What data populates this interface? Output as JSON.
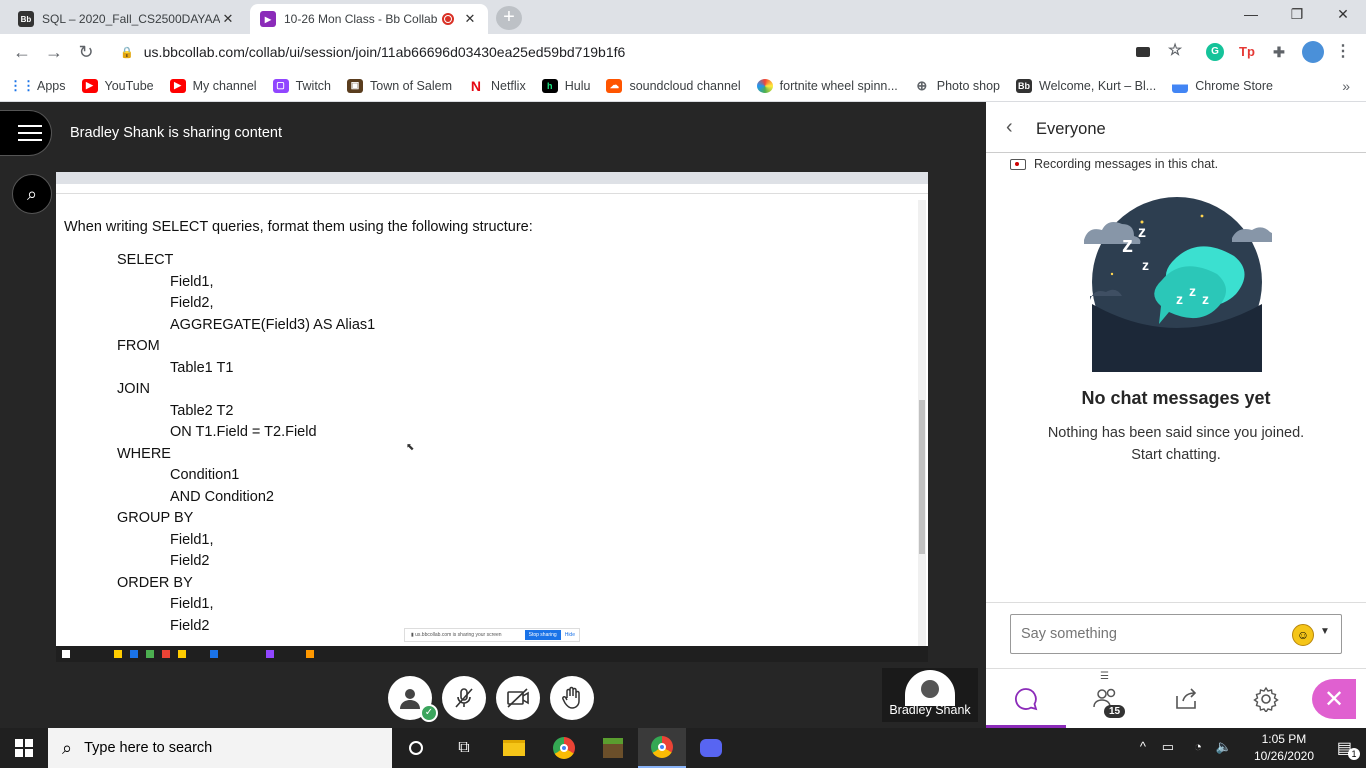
{
  "browser": {
    "tabs": [
      {
        "title": "SQL – 2020_Fall_CS2500DAYAA D",
        "favicon": "Bb",
        "active": false
      },
      {
        "title": "10-26 Mon Class - Bb Collab",
        "active": true
      }
    ],
    "url": "us.bbcollab.com/collab/ui/session/join/11ab66696d03430ea25ed59bd719b1f6",
    "bookmarks": [
      "Apps",
      "YouTube",
      "My channel",
      "Twitch",
      "Town of Salem",
      "Netflix",
      "Hulu",
      "soundcloud channel",
      "fortnite wheel spinn...",
      "Photo shop",
      "Welcome, Kurt – Bl...",
      "Chrome Store"
    ]
  },
  "stage": {
    "sharer_text": "Bradley Shank is sharing content",
    "presenter_name": "Bradley Shank"
  },
  "shared_doc": {
    "intro": "When writing SELECT queries, format them using the following structure:",
    "lines": [
      {
        "indent": 0,
        "text": "SELECT"
      },
      {
        "indent": 1,
        "text": "Field1,"
      },
      {
        "indent": 1,
        "text": "Field2,"
      },
      {
        "indent": 1,
        "text": "AGGREGATE(Field3) AS Alias1"
      },
      {
        "indent": 0,
        "text": "FROM"
      },
      {
        "indent": 1,
        "text": "Table1 T1"
      },
      {
        "indent": 0,
        "text": "JOIN"
      },
      {
        "indent": 1,
        "text": "Table2 T2"
      },
      {
        "indent": 1,
        "text": "ON T1.Field = T2.Field"
      },
      {
        "indent": 0,
        "text": "WHERE"
      },
      {
        "indent": 1,
        "text": "Condition1"
      },
      {
        "indent": 1,
        "text": "AND Condition2"
      },
      {
        "indent": 0,
        "text": "GROUP BY"
      },
      {
        "indent": 1,
        "text": "Field1,"
      },
      {
        "indent": 1,
        "text": "Field2"
      },
      {
        "indent": 0,
        "text": "ORDER BY"
      },
      {
        "indent": 1,
        "text": "Field1,"
      },
      {
        "indent": 1,
        "text": "Field2"
      }
    ]
  },
  "chat": {
    "title": "Everyone",
    "recording_notice": "Recording messages in this chat.",
    "empty_title": "No chat messages yet",
    "empty_sub1": "Nothing has been said since you joined.",
    "empty_sub2": "Start chatting.",
    "input_placeholder": "Say something",
    "attendee_count": "15"
  },
  "taskbar": {
    "search_placeholder": "Type here to search",
    "time": "1:05 PM",
    "date": "10/26/2020",
    "notification_count": "1"
  },
  "colors": {
    "accent_purple": "#8b2bb9",
    "close_pink": "#e060d0",
    "chat_illustration": "#2d3e50",
    "bubble_teal": "#3be0d0"
  }
}
